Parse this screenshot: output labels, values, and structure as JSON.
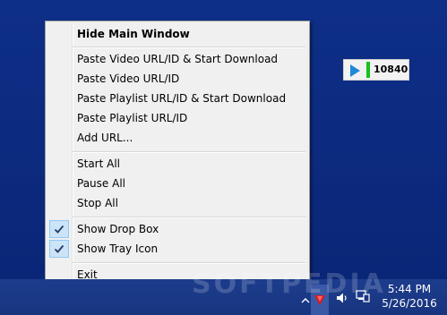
{
  "menu": {
    "header": "Hide Main Window",
    "group1": [
      "Paste Video URL/ID & Start Download",
      "Paste Video URL/ID",
      "Paste Playlist URL/ID & Start Download",
      "Paste Playlist URL/ID",
      "Add URL..."
    ],
    "group2": [
      "Start All",
      "Pause All",
      "Stop All"
    ],
    "checked": [
      {
        "label": "Show Drop Box",
        "checked": true
      },
      {
        "label": "Show Tray Icon",
        "checked": true
      }
    ],
    "exit": "Exit"
  },
  "dropbox": {
    "count": "10840",
    "play_icon": "play-icon",
    "accent": "#1e88d9",
    "bar_color": "#16c21a"
  },
  "taskbar": {
    "time": "5:44 PM",
    "date": "5/26/2016",
    "icons": [
      "chevron-up-icon",
      "app-tray-icon",
      "volume-icon",
      "network-icon"
    ]
  },
  "watermark": "SOFTPEDIA"
}
